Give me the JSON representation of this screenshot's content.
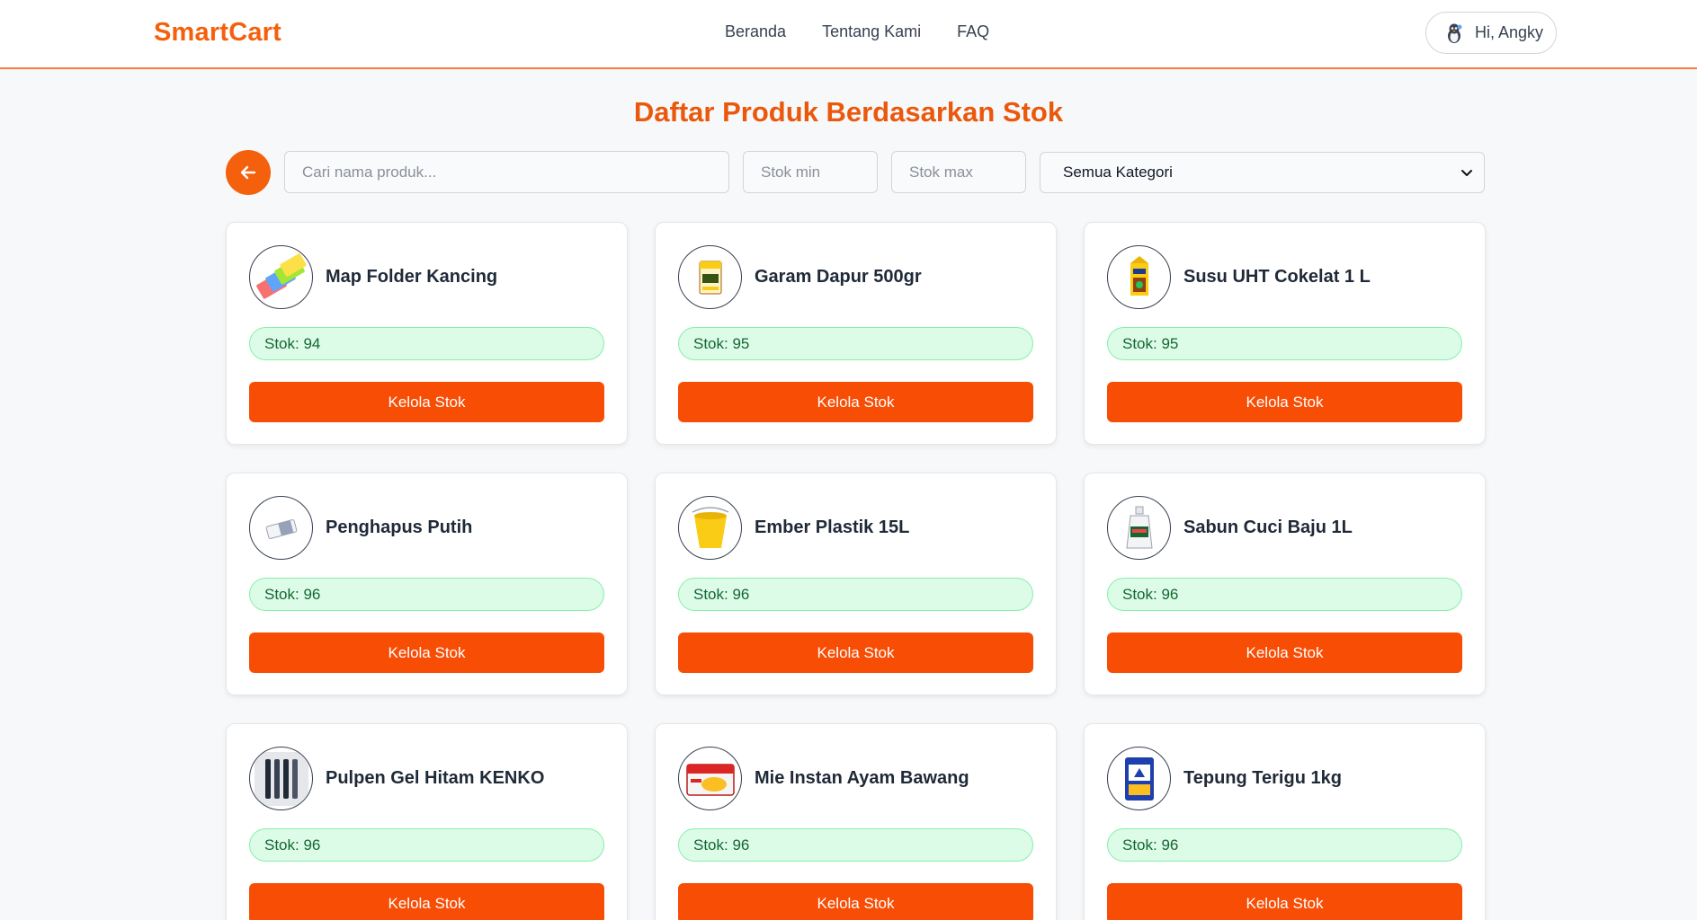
{
  "header": {
    "logo": "SmartCart",
    "nav": [
      "Beranda",
      "Tentang Kami",
      "FAQ"
    ],
    "user_greeting": "Hi, Angky"
  },
  "page_title": "Daftar Produk Berdasarkan Stok",
  "filters": {
    "search_placeholder": "Cari nama produk...",
    "stok_min_placeholder": "Stok min",
    "stok_max_placeholder": "Stok max",
    "category_selected": "Semua Kategori"
  },
  "action_label": "Kelola Stok",
  "products": [
    {
      "name": "Map Folder Kancing",
      "stok": "Stok: 94",
      "icon": "folder-icon"
    },
    {
      "name": "Garam Dapur 500gr",
      "stok": "Stok: 95",
      "icon": "salt-pack-icon"
    },
    {
      "name": "Susu UHT Cokelat 1 L",
      "stok": "Stok: 95",
      "icon": "milk-carton-icon"
    },
    {
      "name": "Penghapus Putih",
      "stok": "Stok: 96",
      "icon": "eraser-icon"
    },
    {
      "name": "Ember Plastik 15L",
      "stok": "Stok: 96",
      "icon": "bucket-icon"
    },
    {
      "name": "Sabun Cuci Baju 1L",
      "stok": "Stok: 96",
      "icon": "detergent-bottle-icon"
    },
    {
      "name": "Pulpen Gel Hitam KENKO",
      "stok": "Stok: 96",
      "icon": "pen-icon"
    },
    {
      "name": "Mie Instan Ayam Bawang",
      "stok": "Stok: 96",
      "icon": "noodle-pack-icon"
    },
    {
      "name": "Tepung Terigu 1kg",
      "stok": "Stok: 96",
      "icon": "flour-bag-icon"
    }
  ],
  "colors": {
    "brand": "#f4600c",
    "button": "#f74d05",
    "badge_bg": "#dcfce7",
    "badge_text": "#166534"
  }
}
